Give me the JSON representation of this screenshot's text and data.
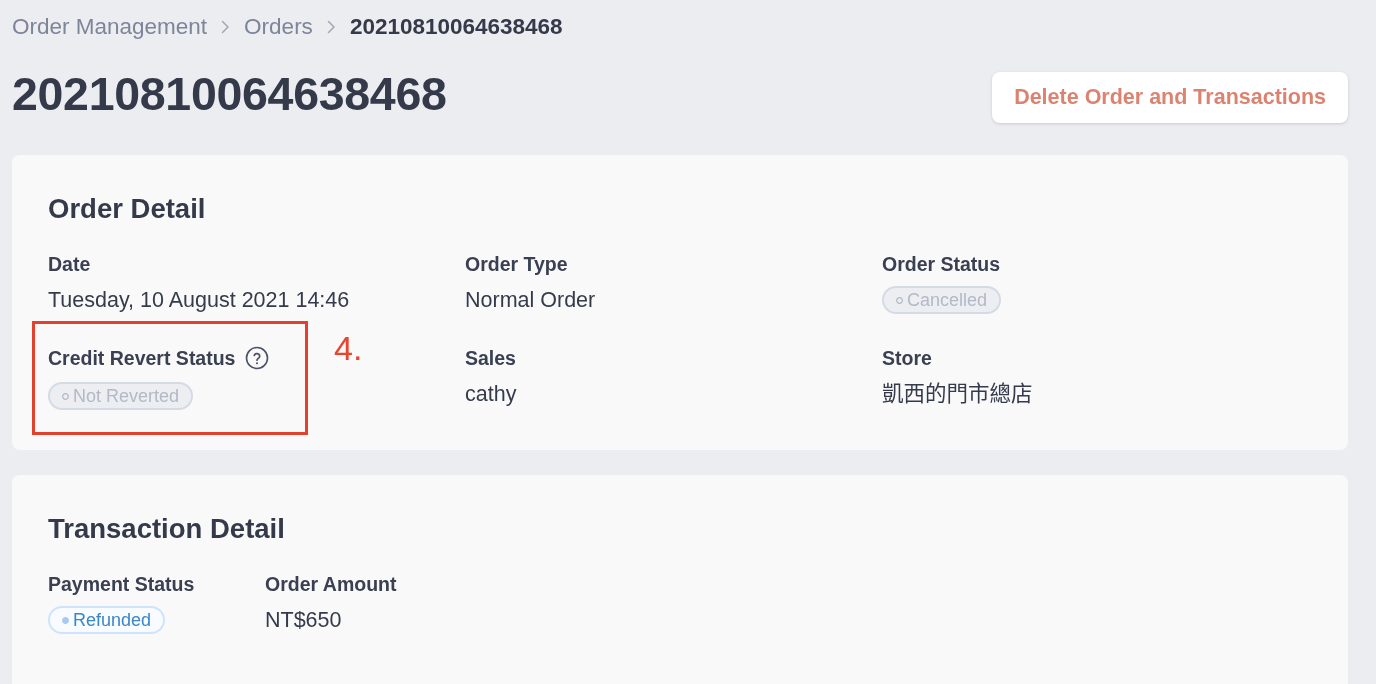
{
  "breadcrumb": [
    {
      "label": "Order Management",
      "current": false
    },
    {
      "label": "Orders",
      "current": false
    },
    {
      "label": "20210810064638468",
      "current": true
    }
  ],
  "header": {
    "title": "20210810064638468",
    "delete_button": "Delete Order and Transactions"
  },
  "order_detail": {
    "title": "Order Detail",
    "fields": [
      {
        "kind": "text",
        "label": "Date",
        "help": false,
        "value": "Tuesday, 10 August 2021 14:46"
      },
      {
        "kind": "text",
        "label": "Order Type",
        "help": false,
        "value": "Normal Order"
      },
      {
        "kind": "neutral",
        "label": "Order Status",
        "help": false,
        "value": "Cancelled"
      },
      {
        "kind": "neutral",
        "label": "Credit Revert Status",
        "help": true,
        "value": "Not Reverted",
        "callout": "4."
      },
      {
        "kind": "text",
        "label": "Sales",
        "help": false,
        "value": "cathy"
      },
      {
        "kind": "text",
        "label": "Store",
        "help": false,
        "value": "凱西的門市總店"
      }
    ]
  },
  "transaction_detail": {
    "title": "Transaction Detail",
    "fields": [
      {
        "kind": "info",
        "label": "Payment Status",
        "help": false,
        "value": "Refunded"
      },
      {
        "kind": "text",
        "label": "Order Amount",
        "help": false,
        "value": "NT$650"
      }
    ]
  }
}
